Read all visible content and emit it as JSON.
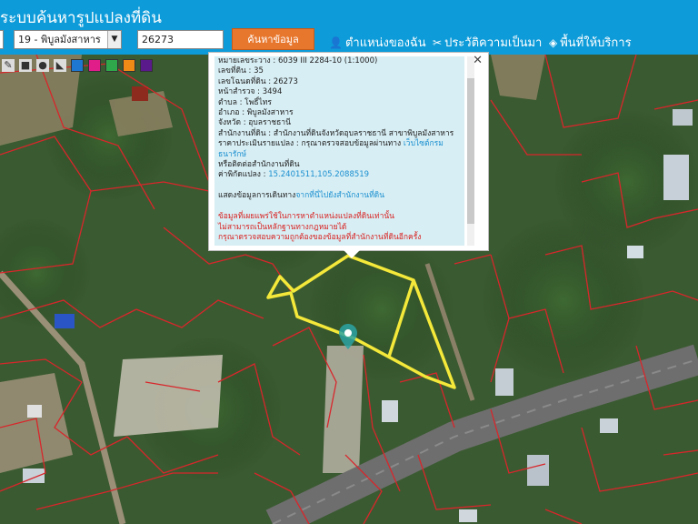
{
  "header": {
    "title": "ระบบค้นหารูปแปลงที่ดิน",
    "district_select": "19 - พิบูลมังสาหาร",
    "parcel_input": "26273",
    "search_button": "ค้นหาข้อมูล",
    "links": [
      {
        "label": "ตำแหน่งของฉัน",
        "icon": "person-pin-icon"
      },
      {
        "label": "ประวัติความเป็นมา",
        "icon": "tools-icon"
      },
      {
        "label": "พื้นที่ให้บริการ",
        "icon": "map-tag-icon"
      }
    ]
  },
  "toolbar": {
    "tools": [
      "pencil-icon",
      "square-icon",
      "circle-icon",
      "fill-icon"
    ],
    "swatches": [
      "#1e78d2",
      "#e11d8a",
      "#2ea84a",
      "#f08a17",
      "#5b1a8c"
    ]
  },
  "popup": {
    "sheet": "หมายเลขระวาง : 6039 III 2284-10 (1:1000)",
    "land_no": "เลขที่ดิน : 35",
    "deed_no": "เลขโฉนดที่ดิน : 26273",
    "survey_page": "หน้าสำรวจ : 3494",
    "subdistrict": "ตำบล : โพธิ์ไทร",
    "district": "อำเภอ : พิบูลมังสาหาร",
    "province": "จังหวัด : อุบลราชธานี",
    "office": "สำนักงานที่ดิน : สำนักงานที่ดินจังหวัดอุบลราชธานี สาขาพิบูลมังสาหาร",
    "appraisal_prefix": "ราคาประเมินรายแปลง : กรุณาตรวจสอบข้อมูลผ่านทาง ",
    "appraisal_link": "เว็บไซต์กรมธนารักษ์",
    "contact": "หรือติดต่อสำนักงานที่ดิน",
    "coord_label": "ค่าพิกัดแปลง : ",
    "coord_value": "15.2401511,105.2088519",
    "route_prefix": "แสดงข้อมูลการเดินทาง",
    "route_link": "จากที่นี่ไปยังสำนักงานที่ดิน",
    "disclaimer_1": "ข้อมูลที่เผยแพร่ใช้ในการหาตำแหน่งแปลงที่ดินเท่านั้น",
    "disclaimer_2": "ไม่สามารถเป็นหลักฐานทางกฎหมายได้",
    "disclaimer_3": "กรุณาตรวจสอบความถูกต้องของข้อมูลที่สำนักงานที่ดินอีกครั้ง"
  },
  "map": {
    "parcel_color": "#f4e83a",
    "boundary_color": "#d8262b"
  }
}
